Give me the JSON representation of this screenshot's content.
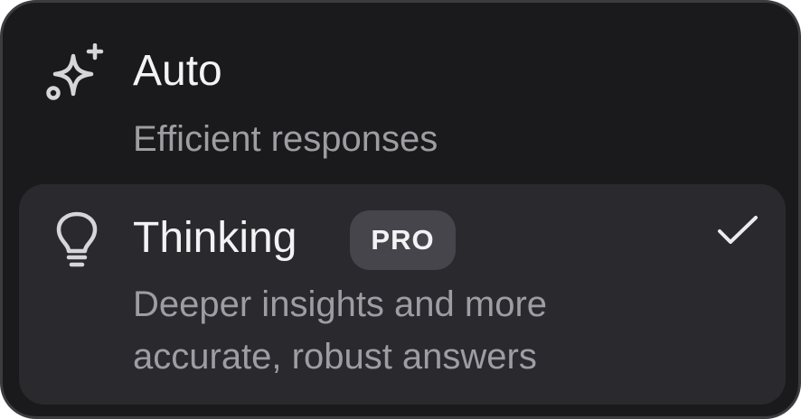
{
  "menu": {
    "options": [
      {
        "icon": "sparkle-icon",
        "title": "Auto",
        "description": "Efficient responses",
        "selected": false
      },
      {
        "icon": "lightbulb-icon",
        "title": "Thinking",
        "badge": "PRO",
        "description_lines": [
          "Deeper insights and more",
          "accurate, robust answers"
        ],
        "selected": true,
        "selected_icon": "checkmark-icon"
      }
    ]
  },
  "colors": {
    "background": "#1a1a1c",
    "selected_row": "#2a2a2e",
    "badge": "#45454b",
    "title_text": "#f3f3f5",
    "secondary_text": "#9d9da3"
  }
}
